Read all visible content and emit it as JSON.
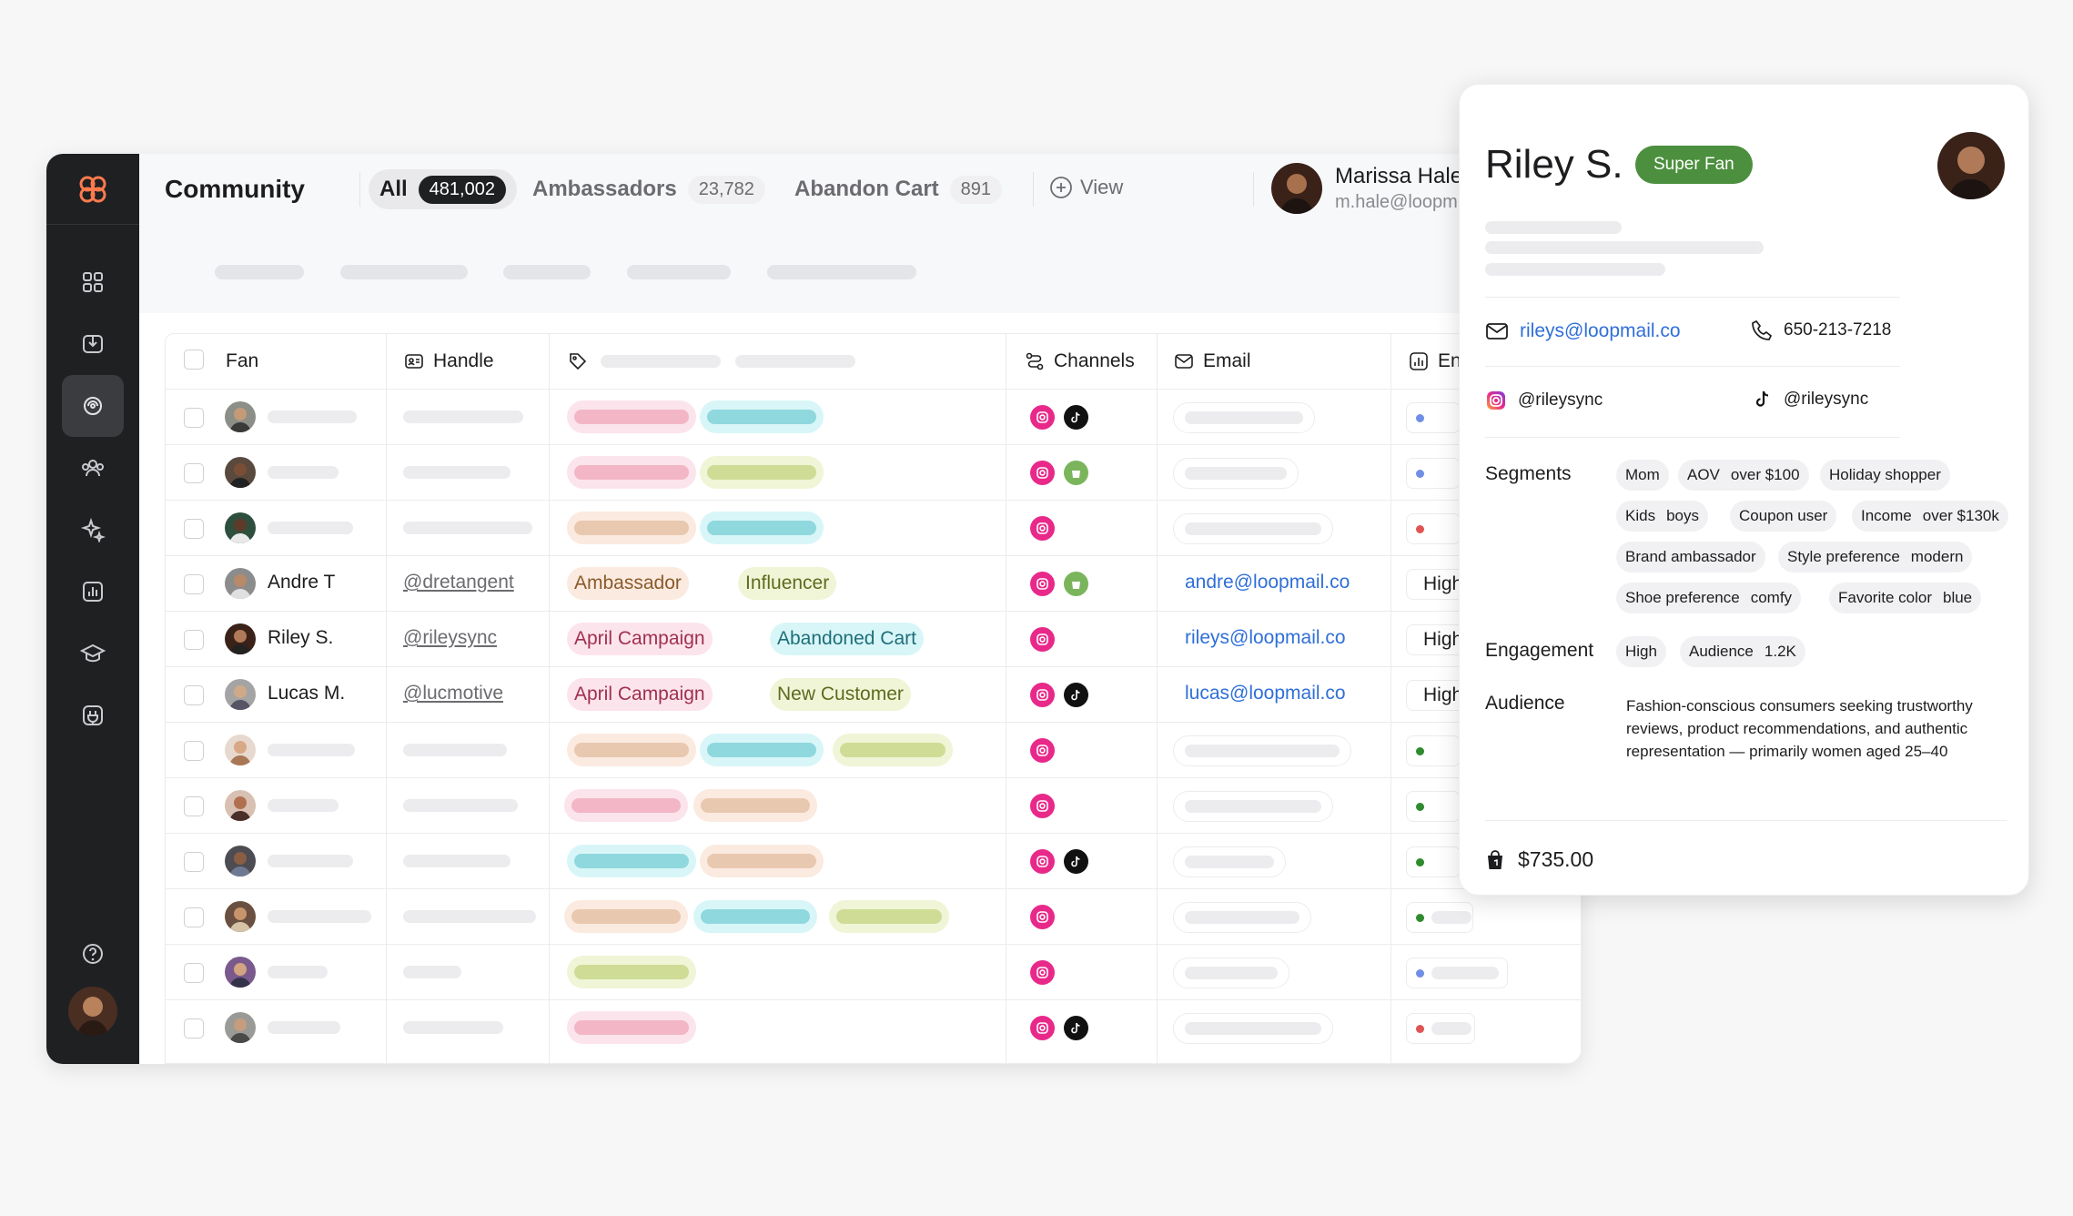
{
  "header": {
    "title": "Community",
    "tabs": [
      {
        "label": "All",
        "count": "481,002"
      },
      {
        "label": "Ambassadors",
        "count": "23,782"
      },
      {
        "label": "Abandon Cart",
        "count": "891"
      }
    ],
    "view_label": "View",
    "user": {
      "name": "Marissa Hale",
      "email": "m.hale@loopm"
    }
  },
  "columns": {
    "fan": "Fan",
    "handle": "Handle",
    "channels": "Channels",
    "email": "Email",
    "engagement": "En"
  },
  "rows": [
    {
      "name": "Andre T",
      "handle": "@dretangent",
      "tags": [
        "Ambassador",
        "Influencer"
      ],
      "channels": [
        "instagram",
        "shopify"
      ],
      "email": "andre@loopmail.co",
      "engagement": "High"
    },
    {
      "name": "Riley S.",
      "handle": "@rileysync",
      "tags": [
        "April Campaign",
        "Abandoned Cart"
      ],
      "channels": [
        "instagram"
      ],
      "email": "rileys@loopmail.co",
      "engagement": "High"
    },
    {
      "name": "Lucas M.",
      "handle": "@lucmotive",
      "tags": [
        "April Campaign",
        "New Customer"
      ],
      "channels": [
        "instagram",
        "tiktok"
      ],
      "email": "lucas@loopmail.co",
      "engagement": "High"
    }
  ],
  "colors": {
    "instagram": "#e8298a",
    "shopify": "#7ab55c",
    "tiktok": "#111111",
    "link": "#2f6fd8",
    "super_fan": "#4c8f3e",
    "high": "#2e8b2e"
  },
  "card": {
    "name": "Riley S.",
    "badge": "Super Fan",
    "email": "rileys@loopmail.co",
    "phone": "650-213-7218",
    "instagram": "@rileysync",
    "tiktok": "@rileysync",
    "segments_label": "Segments",
    "segments": [
      {
        "label": "Mom",
        "value": ""
      },
      {
        "label": "AOV",
        "value": "over $100"
      },
      {
        "label": "Holiday shopper",
        "value": ""
      },
      {
        "label": "Kids",
        "value": "boys"
      },
      {
        "label": "Coupon user",
        "value": ""
      },
      {
        "label": "Income",
        "value": "over $130k"
      },
      {
        "label": "Brand ambassador",
        "value": ""
      },
      {
        "label": "Style preference",
        "value": "modern"
      },
      {
        "label": "Shoe preference",
        "value": "comfy"
      },
      {
        "label": "Favorite color",
        "value": "blue"
      }
    ],
    "engagement_label": "Engagement",
    "engagement": [
      {
        "label": "High",
        "value": ""
      },
      {
        "label": "Audience",
        "value": "1.2K"
      }
    ],
    "audience_label": "Audience",
    "audience_text": "Fashion-conscious consumers seeking trustworthy reviews, product recommendations, and authentic representation — primarily women aged 25–40",
    "revenue": "$735.00"
  }
}
